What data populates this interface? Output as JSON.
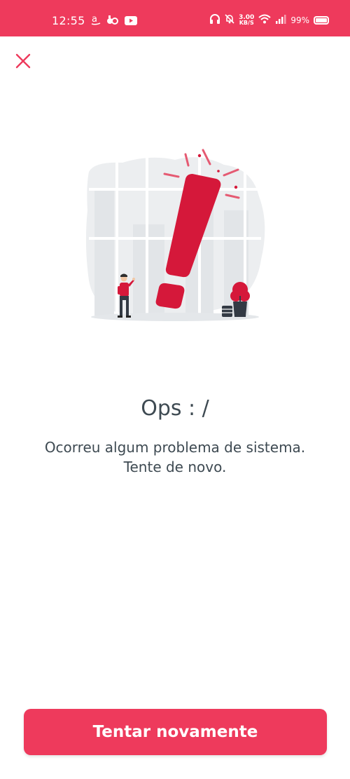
{
  "status_bar": {
    "time": "12:55",
    "network_speed_value": "3.00",
    "network_speed_unit": "KB/S",
    "battery_percent": "99%",
    "background_color": "#ee3a5c",
    "left_icons": [
      "amazon-icon",
      "app-icon",
      "youtube-icon"
    ],
    "right_icons": [
      "headphones-icon",
      "bell-muted-icon",
      "wifi-icon",
      "signal-icon",
      "battery-icon"
    ]
  },
  "header": {
    "close_icon": "close-icon",
    "accent_color": "#ee3a5c"
  },
  "error": {
    "title": "Ops : /",
    "message_line1": "Ocorreu algum problema de sistema.",
    "message_line2": "Tente de novo.",
    "text_color": "#3e4a52",
    "illustration_color": "#d5183a"
  },
  "actions": {
    "retry_label": "Tentar novamente",
    "button_color": "#ee3a5c"
  }
}
